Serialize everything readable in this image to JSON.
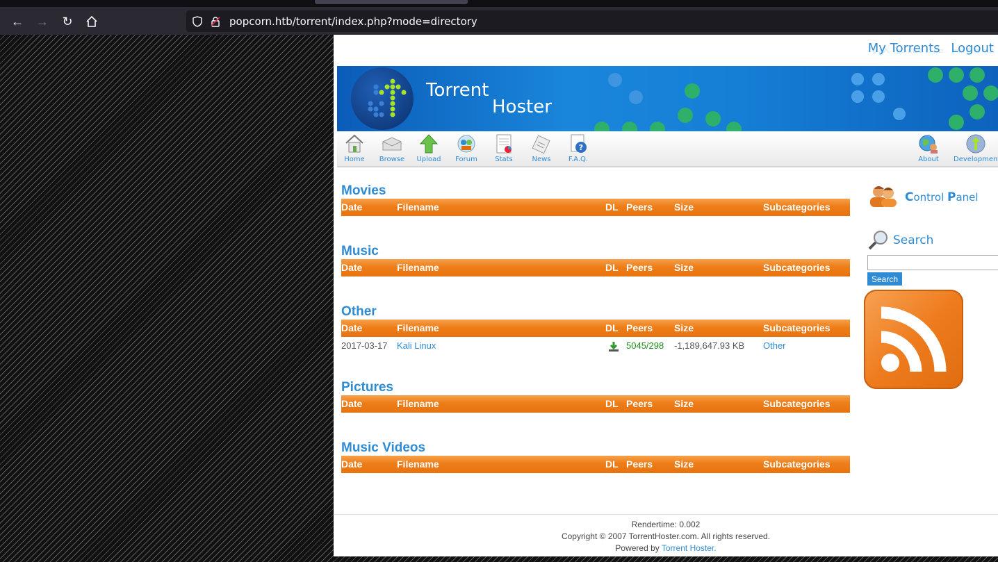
{
  "browser": {
    "url": "popcorn.htb/torrent/index.php?mode=directory",
    "icons": [
      "back-arrow-icon",
      "forward-arrow-icon",
      "reload-icon",
      "home-icon",
      "shield-icon",
      "lock-warning-icon"
    ]
  },
  "page": {
    "top_links": [
      "My Torrents",
      "Logout"
    ],
    "banner": {
      "title_line1": "Torrent",
      "title_line2": "Hoster"
    },
    "menu": [
      {
        "label": "Home",
        "icon": "house-icon"
      },
      {
        "label": "Browse",
        "icon": "browse-box-icon"
      },
      {
        "label": "Upload",
        "icon": "upload-arrow-icon"
      },
      {
        "label": "Forum",
        "icon": "forum-icon"
      },
      {
        "label": "Stats",
        "icon": "stats-icon"
      },
      {
        "label": "News",
        "icon": "news-icon"
      },
      {
        "label": "F.A.Q.",
        "icon": "faq-icon"
      },
      {
        "label": "About",
        "icon": "about-globe-icon"
      },
      {
        "label": "Development",
        "icon": "development-icon"
      }
    ],
    "columns": {
      "date": "Date",
      "filename": "Filename",
      "dl": "DL",
      "peers": "Peers",
      "size": "Size",
      "subcategories": "Subcategories"
    },
    "sections": [
      {
        "title": "Movies",
        "rows": []
      },
      {
        "title": "Music",
        "rows": []
      },
      {
        "title": "Other",
        "rows": [
          {
            "date": "2017-03-17",
            "filename": "Kali Linux",
            "peers": "5045/298",
            "size": "-1,189,647.93 KB",
            "subcategory": "Other"
          }
        ]
      },
      {
        "title": "Pictures",
        "rows": []
      },
      {
        "title": "Music Videos",
        "rows": []
      }
    ],
    "sidebar": {
      "control_panel": {
        "first_c": "C",
        "rest1": "ontrol ",
        "first_p": "P",
        "rest2": "anel"
      },
      "search_heading": "Search",
      "search_button": "Search",
      "search_value": ""
    },
    "footer": {
      "rendertime": "Rendertime: 0.002",
      "copyright": "Copyright © 2007 TorrentHoster.com. All rights reserved.",
      "powered_prefix": "Powered by",
      "powered_link": "Torrent Hoster."
    },
    "colors": {
      "link_blue": "#2f8bd3",
      "header_orange": "#ee7d18",
      "peers_green": "#1c8a1c"
    }
  }
}
